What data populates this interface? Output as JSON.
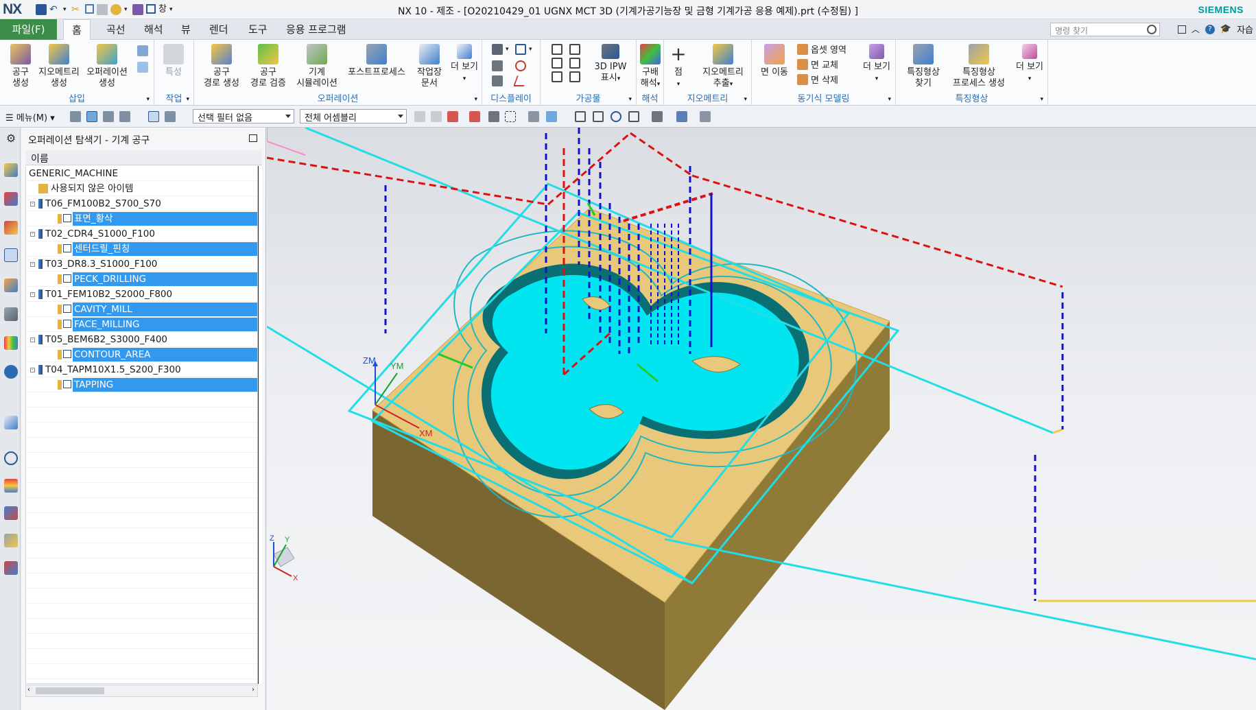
{
  "window": {
    "title": "NX 10 - 제조 - [O20210429_01 UGNX MCT 3D (기계가공기능장 및 금형 기계가공 응용 예제).prt (수정됨) ]",
    "logo": "NX",
    "brand": "SIEMENS",
    "quick_access": {
      "window_menu": "창"
    }
  },
  "menubar": {
    "file": "파일(F)",
    "tabs": [
      "홈",
      "곡선",
      "해석",
      "뷰",
      "렌더",
      "도구",
      "응용 프로그램"
    ],
    "search_placeholder": "명령 찾기",
    "right_label": "자습"
  },
  "ribbon": {
    "groups": {
      "insert": "삽입",
      "job": "작업",
      "operation": "오퍼레이션",
      "display": "디스플레이",
      "workpiece": "가공물",
      "analysis": "해석",
      "geometry": "지오메트리",
      "sync": "동기식 모델링",
      "feature": "특징형상"
    },
    "buttons": {
      "tool_create": [
        "공구",
        "생성"
      ],
      "geometry_create": [
        "지오메트리",
        "생성"
      ],
      "operation_create": [
        "오퍼레이션",
        "생성"
      ],
      "properties": "특성",
      "path_generate": [
        "공구",
        "경로 생성"
      ],
      "path_verify": [
        "공구",
        "경로 검증"
      ],
      "machine_sim": [
        "기계",
        "시뮬레이션"
      ],
      "postprocess": "포스트프로세스",
      "shop_doc": [
        "작업장",
        "문서"
      ],
      "more_view_1": [
        "더 보기"
      ],
      "ipw_show": [
        "3D IPW",
        "표시"
      ],
      "gouge_check": [
        "구배",
        "해석"
      ],
      "point": "점",
      "geometry_extract": [
        "지오메트리",
        "추출"
      ],
      "face_move": "면 이동",
      "offset_region": "옵셋 영역",
      "face_replace": "면 교체",
      "face_delete": "면 삭제",
      "more_view_2": [
        "더 보기"
      ],
      "feature_find": [
        "특징형상",
        "찾기"
      ],
      "feature_process": [
        "특징형상",
        "프로세스 생성"
      ],
      "more_view_3": [
        "더 보기"
      ]
    }
  },
  "toolbar": {
    "menu_label": "메뉴(M)",
    "filter": "선택 필터 없음",
    "assembly": "전체 어셈블리"
  },
  "navigator": {
    "title": "오퍼레이션 탐색기 - 기계 공구",
    "column": "이름",
    "rows": [
      {
        "text": "GENERIC_MACHINE",
        "level": 0,
        "selected": false,
        "kind": "machine"
      },
      {
        "text": "사용되지 않은 아이템",
        "level": 1,
        "selected": false,
        "kind": "folder"
      },
      {
        "text": "T06_FM100B2_S700_S70",
        "level": 1,
        "selected": false,
        "kind": "tool",
        "expander": "-"
      },
      {
        "text": "표면_황삭",
        "level": 2,
        "selected": true,
        "kind": "op"
      },
      {
        "text": "T02_CDR4_S1000_F100",
        "level": 1,
        "selected": false,
        "kind": "tool",
        "expander": "-"
      },
      {
        "text": "센터드릴_핀칭",
        "level": 2,
        "selected": true,
        "kind": "op"
      },
      {
        "text": "T03_DR8.3_S1000_F100",
        "level": 1,
        "selected": false,
        "kind": "tool",
        "expander": "-"
      },
      {
        "text": "PECK_DRILLING",
        "level": 2,
        "selected": true,
        "kind": "op"
      },
      {
        "text": "T01_FEM10B2_S2000_F800",
        "level": 1,
        "selected": false,
        "kind": "tool",
        "expander": "-"
      },
      {
        "text": "CAVITY_MILL",
        "level": 2,
        "selected": true,
        "kind": "op"
      },
      {
        "text": "FACE_MILLING",
        "level": 2,
        "selected": true,
        "kind": "op"
      },
      {
        "text": "T05_BEM6B2_S3000_F400",
        "level": 1,
        "selected": false,
        "kind": "tool",
        "expander": "-"
      },
      {
        "text": "CONTOUR_AREA",
        "level": 2,
        "selected": true,
        "kind": "op"
      },
      {
        "text": "T04_TAPM10X1.5_S200_F300",
        "level": 1,
        "selected": false,
        "kind": "tool",
        "expander": "-"
      },
      {
        "text": "TAPPING",
        "level": 2,
        "selected": true,
        "kind": "op"
      }
    ]
  },
  "viewport": {
    "axis_labels": {
      "zm": "ZM",
      "ym": "YM",
      "xm": "XM",
      "z": "Z",
      "y": "Y",
      "x": "X"
    }
  },
  "colors": {
    "file_tab": "#3c8d49",
    "selection": "#3399ee",
    "group_label": "#2b6cb0",
    "cavity": "#00e5ef",
    "stock_top": "#e8c87a",
    "stock_side": "#8a7436",
    "toolpath_cyan": "#22dde6",
    "rapid_red": "#dd1111",
    "feed_blue": "#1111cc"
  }
}
